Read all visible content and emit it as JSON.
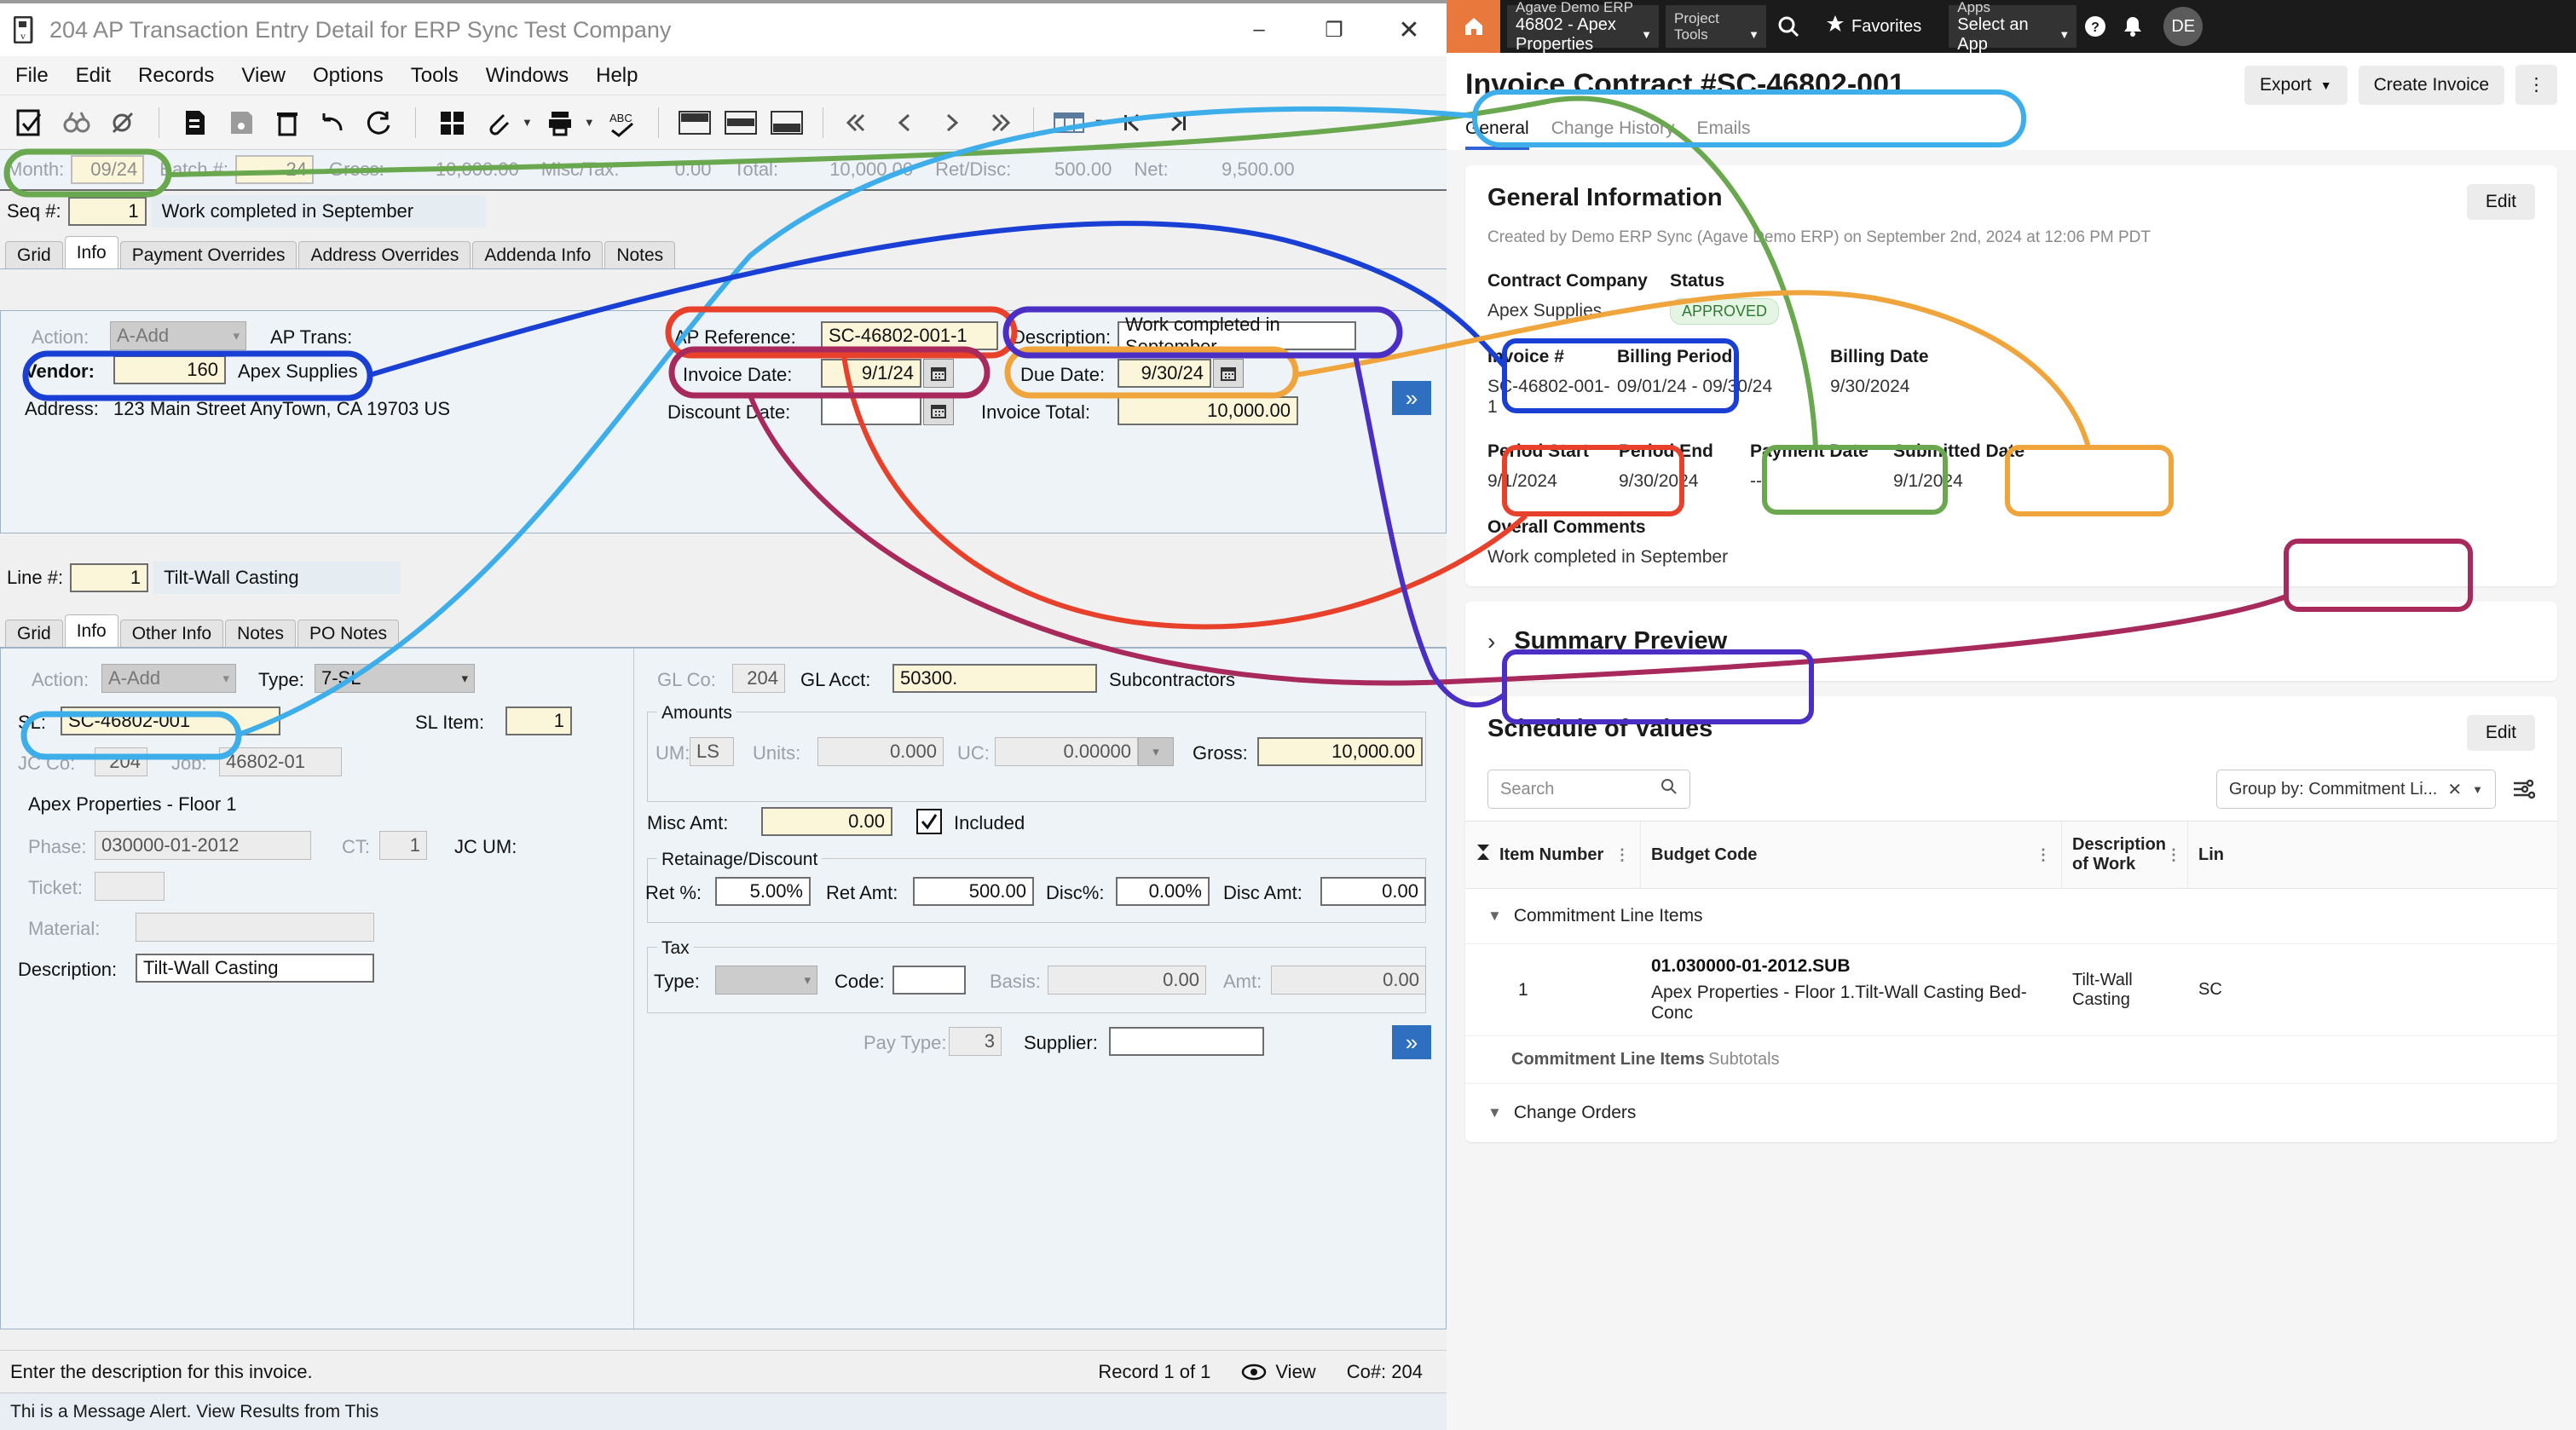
{
  "erp": {
    "title": "204 AP Transaction Entry Detail for ERP Sync Test Company",
    "window_controls": {
      "minimize": "–",
      "maximize": "❐",
      "close": "✕"
    },
    "menu": [
      "File",
      "Edit",
      "Records",
      "View",
      "Options",
      "Tools",
      "Windows",
      "Help"
    ],
    "summary_bar": {
      "month_label": "Month:",
      "month_value": "09/24",
      "batch_label": "Batch #:",
      "batch_value": "24",
      "gross_label": "Gross:",
      "gross_value": "10,000.00",
      "misctax_label": "Misc/Tax:",
      "misctax_value": "0.00",
      "total_label": "Total:",
      "total_value": "10,000.00",
      "retdisc_label": "Ret/Disc:",
      "retdisc_value": "500.00",
      "net_label": "Net:",
      "net_value": "9,500.00"
    },
    "seq": {
      "label": "Seq #:",
      "value": "1",
      "description": "Work completed in September"
    },
    "header_tabs": [
      "Grid",
      "Info",
      "Payment Overrides",
      "Address Overrides",
      "Addenda Info",
      "Notes"
    ],
    "header_active_tab": "Info",
    "header_form": {
      "action_label": "Action:",
      "action_value": "A-Add",
      "aptrans_label": "AP Trans:",
      "aptrans_value": "",
      "vendor_label": "Vendor:",
      "vendor_value": "160",
      "vendor_name": "Apex Supplies",
      "address_label": "Address:",
      "address_value": "123 Main Street  AnyTown, CA  19703  US",
      "apref_label": "AP Reference:",
      "apref_value": "SC-46802-001-1",
      "invdate_label": "Invoice Date:",
      "invdate_value": "9/1/24",
      "discdate_label": "Discount Date:",
      "discdate_value": "",
      "descr_label": "Description:",
      "descr_value": "Work completed in September",
      "duedate_label": "Due Date:",
      "duedate_value": "9/30/24",
      "invtotal_label": "Invoice Total:",
      "invtotal_value": "10,000.00"
    },
    "line": {
      "label": "Line #:",
      "value": "1",
      "description": "Tilt-Wall Casting"
    },
    "line_tabs": [
      "Grid",
      "Info",
      "Other Info",
      "Notes",
      "PO Notes"
    ],
    "line_active_tab": "Info",
    "line_form": {
      "action_label": "Action:",
      "action_value": "A-Add",
      "type_label": "Type:",
      "type_value": "7-SL",
      "sl_label": "SL:",
      "sl_value": "SC-46802-001",
      "sl_value2": "",
      "slitem_label": "SL Item:",
      "slitem_value": "1",
      "jcco_label": "JC Co:",
      "jcco_value": "204",
      "job_label": "Job:",
      "job_value": "46802-01",
      "job_name": "Apex Properties - Floor 1",
      "phase_label": "Phase:",
      "phase_value": "030000-01-2012",
      "ct_label": "CT:",
      "ct_value": "1",
      "jcum_label": "JC UM:",
      "jcum_value": "",
      "ticket_label": "Ticket:",
      "ticket_value": "",
      "material_label": "Material:",
      "material_value": "",
      "description_label": "Description:",
      "description_value": "Tilt-Wall Casting",
      "glco_label": "GL Co:",
      "glco_value": "204",
      "glacct_label": "GL Acct:",
      "glacct_value": "50300.",
      "glacct_name": "Subcontractors",
      "amounts_legend": "Amounts",
      "um_label": "UM:",
      "um_value": "LS",
      "units_label": "Units:",
      "units_value": "0.000",
      "uc_label": "UC:",
      "uc_value": "0.00000",
      "gross_label": "Gross:",
      "gross_value": "10,000.00",
      "miscamt_label": "Misc Amt:",
      "miscamt_value": "0.00",
      "included_label": "Included",
      "retdisc_legend": "Retainage/Discount",
      "retpct_label": "Ret %:",
      "retpct_value": "5.00%",
      "retamt_label": "Ret Amt:",
      "retamt_value": "500.00",
      "discpct_label": "Disc%:",
      "discpct_value": "0.00%",
      "discamt_label": "Disc Amt:",
      "discamt_value": "0.00",
      "tax_legend": "Tax",
      "taxtype_label": "Type:",
      "taxtype_value": "",
      "taxcode_label": "Code:",
      "taxcode_value": "",
      "basis_label": "Basis:",
      "basis_value": "0.00",
      "amt_label": "Amt:",
      "amt_value": "0.00",
      "paytype_label": "Pay Type:",
      "paytype_value": "3",
      "supplier_label": "Supplier:",
      "supplier_value": ""
    },
    "status": {
      "hint": "Enter the description for this invoice.",
      "record": "Record 1 of 1",
      "view": "View",
      "co": "Co#: 204"
    },
    "taskbar_text": "Thi is a Message Alert. View Results from This"
  },
  "web": {
    "topbar": {
      "home_icon": "home-icon",
      "erp_selector_top": "Agave Demo ERP",
      "erp_selector_bottom": "46802 - Apex Properties",
      "project_tools": "Project Tools",
      "search_icon": "search-icon",
      "favorites": "Favorites",
      "apps_top": "Apps",
      "apps_bottom": "Select an App",
      "help_icon": "help-icon",
      "bell_icon": "notification-icon",
      "avatar_initials": "DE"
    },
    "page_title": "Invoice Contract #SC-46802-001",
    "actions": {
      "export": "Export",
      "create_invoice": "Create Invoice",
      "more": "⋮"
    },
    "tabs": [
      {
        "label": "General",
        "active": true
      },
      {
        "label": "Change History",
        "active": false
      },
      {
        "label": "Emails",
        "active": false
      }
    ],
    "general": {
      "heading": "General Information",
      "edit": "Edit",
      "created": "Created by Demo ERP Sync (Agave Demo ERP) on September 2nd, 2024 at 12:06 PM PDT",
      "fields_row1": [
        {
          "label": "Contract Company",
          "value": "Apex Supplies"
        },
        {
          "label": "Status",
          "value": "APPROVED",
          "is_badge": true
        }
      ],
      "fields_row2": [
        {
          "label": "Invoice #",
          "value": "SC-46802-001-1"
        },
        {
          "label": "Billing Period",
          "value": "09/01/24 - 09/30/24"
        },
        {
          "label": "Billing Date",
          "value": "9/30/2024"
        }
      ],
      "fields_row3": [
        {
          "label": "Period Start",
          "value": "9/1/2024"
        },
        {
          "label": "Period End",
          "value": "9/30/2024"
        },
        {
          "label": "Payment Date",
          "value": "--"
        },
        {
          "label": "Submitted Date",
          "value": "9/1/2024"
        }
      ],
      "comments_label": "Overall Comments",
      "comments_value": "Work completed in September"
    },
    "summary_preview": {
      "heading": "Summary Preview",
      "chevron": "›"
    },
    "sov": {
      "heading": "Schedule of Values",
      "edit": "Edit",
      "search_placeholder": "Search",
      "group_by": "Group by: Commitment Li...",
      "columns": [
        "Item Number",
        "Budget Code",
        "Description of Work",
        "Lin"
      ],
      "group_rows": [
        {
          "name": "Commitment Line Items",
          "expanded": true
        }
      ],
      "rows": [
        {
          "item_number": "1",
          "budget_code_main": "01.030000-01-2012.SUB",
          "budget_code_sub": "Apex Properties - Floor 1.Tilt-Wall Casting Bed-Conc",
          "description": "Tilt-Wall Casting",
          "line": "SC"
        }
      ],
      "subtotal_strong": "Commitment Line Items",
      "subtotal_weak": "Subtotals",
      "group2": "Change Orders"
    }
  },
  "annotation_colors": {
    "green": "#6aa84f",
    "lightblue": "#3daee9",
    "blue": "#1a3fd4",
    "red": "#e8412b",
    "maroon": "#a82a5c",
    "orange": "#f0a53c",
    "purple": "#4b2fc4"
  }
}
